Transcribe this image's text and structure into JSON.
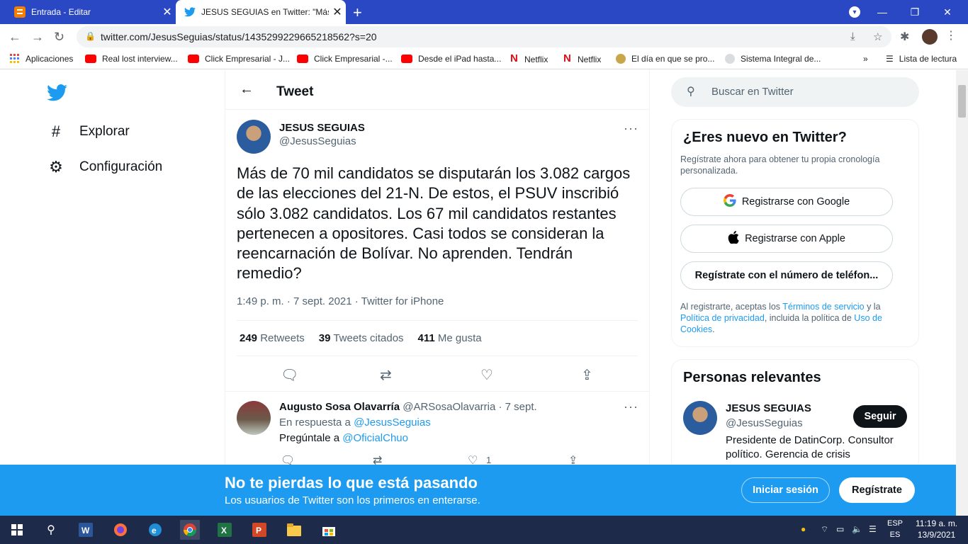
{
  "browser": {
    "tabs": [
      {
        "title": "Entrada - Editar",
        "icon": "blogger-icon",
        "active": false
      },
      {
        "title": "JESUS SEGUIAS en Twitter: \"Más d",
        "icon": "twitter-icon",
        "active": true
      }
    ],
    "url": "twitter.com/JesusSeguias/status/1435299229665218562?s=20",
    "bookmarks": [
      {
        "label": "Aplicaciones",
        "icon": "apps-icon"
      },
      {
        "label": "Real lost interview...",
        "icon": "youtube-icon"
      },
      {
        "label": "Click Empresarial - J...",
        "icon": "youtube-icon"
      },
      {
        "label": "Click Empresarial -...",
        "icon": "youtube-icon"
      },
      {
        "label": "Desde el iPad hasta...",
        "icon": "youtube-icon"
      },
      {
        "label": "Netflix",
        "icon": "netflix-icon"
      },
      {
        "label": "Netflix",
        "icon": "netflix-icon"
      },
      {
        "label": "El día en que se pro...",
        "icon": "sun-icon"
      },
      {
        "label": "Sistema Integral de...",
        "icon": "globe-icon"
      }
    ],
    "overflow": "»",
    "reading_list": "Lista de lectura"
  },
  "twitter": {
    "nav": [
      {
        "label": "Explorar",
        "icon": "hashtag-icon"
      },
      {
        "label": "Configuración",
        "icon": "gear-icon"
      }
    ],
    "header_title": "Tweet",
    "tweet": {
      "author_name": "JESUS SEGUIAS",
      "author_handle": "@JesusSeguias",
      "text": "Más de 70 mil candidatos se disputarán los 3.082 cargos de las elecciones del 21-N. De estos, el PSUV inscribió sólo 3.082 candidatos. Los 67 mil candidatos restantes pertenecen a opositores. Casi todos se consideran la reencarnación de Bolívar. No aprenden. Tendrán remedio?",
      "meta": "1:49 p. m. · 7 sept. 2021 · Twitter for iPhone",
      "retweets": "249",
      "retweets_label": "Retweets",
      "quotes": "39",
      "quotes_label": "Tweets citados",
      "likes": "411",
      "likes_label": "Me gusta"
    },
    "reply": {
      "author_name": "Augusto Sosa Olavarría",
      "author_handle": "@ARSosaOlavarria",
      "date": " · 7 sept.",
      "in_reply_prefix": "En respuesta a ",
      "in_reply_handle": "@JesusSeguias",
      "text_prefix": "Pregúntale a ",
      "text_mention": "@OficialChuo",
      "like_count": "1"
    },
    "search_placeholder": "Buscar en Twitter",
    "signup": {
      "title": "¿Eres nuevo en Twitter?",
      "subtitle": "Regístrate ahora para obtener tu propia cronología personalizada.",
      "google": "Registrarse con Google",
      "apple": "Registrarse con Apple",
      "phone": "Regístrate con el número de teléfon...",
      "terms_1": "Al registrarte, aceptas los ",
      "terms_link1": "Términos de servicio",
      "terms_2": " y la ",
      "terms_link2": "Política de privacidad",
      "terms_3": ", incluida la política de ",
      "terms_link3": "Uso de Cookies",
      "terms_4": "."
    },
    "relevant": {
      "title": "Personas relevantes",
      "name": "JESUS SEGUIAS",
      "handle": "@JesusSeguias",
      "bio": "Presidente de DatinCorp. Consultor político. Gerencia de crisis",
      "follow": "Seguir"
    },
    "banner": {
      "title": "No te pierdas lo que está pasando",
      "subtitle": "Los usuarios de Twitter son los primeros en enterarse.",
      "login": "Iniciar sesión",
      "register": "Regístrate"
    }
  },
  "taskbar": {
    "lang_1": "ESP",
    "lang_2": "ES",
    "time": "11:19 a. m.",
    "date": "13/9/2021"
  },
  "colors": {
    "twitter_blue": "#1d9bf0",
    "chrome_tabbar": "#2a47c4"
  }
}
